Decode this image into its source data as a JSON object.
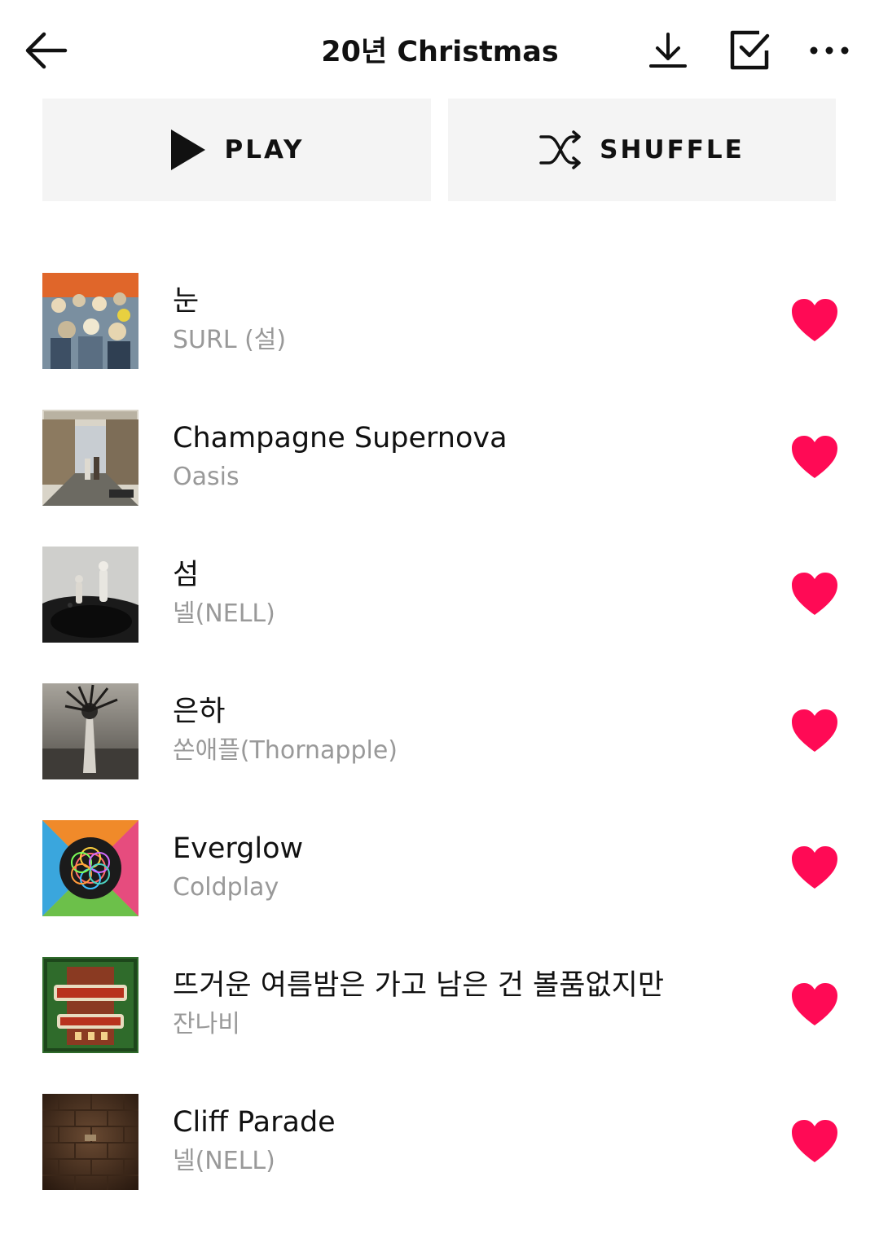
{
  "header": {
    "title": "20년 Christmas",
    "back_icon": "arrow-left-icon",
    "download_icon": "download-icon",
    "select_icon": "checkbox-icon",
    "more_icon": "more-horizontal-icon"
  },
  "actions": {
    "play_label": "PLAY",
    "shuffle_label": "SHUFFLE"
  },
  "colors": {
    "heart": "#ff0a55",
    "button_bg": "#f4f4f4",
    "artist_text": "#999999"
  },
  "tracks": [
    {
      "title": "눈",
      "artist": "SURL (설)",
      "liked": true
    },
    {
      "title": "Champagne Supernova",
      "artist": "Oasis",
      "liked": true
    },
    {
      "title": "섬",
      "artist": "넬(NELL)",
      "liked": true
    },
    {
      "title": "은하",
      "artist": "쏜애플(Thornapple)",
      "liked": true
    },
    {
      "title": "Everglow",
      "artist": "Coldplay",
      "liked": true
    },
    {
      "title": "뜨거운 여름밤은 가고 남은 건 볼품없지만",
      "artist": "잔나비",
      "liked": true
    },
    {
      "title": "Cliff Parade",
      "artist": "넬(NELL)",
      "liked": true
    }
  ]
}
